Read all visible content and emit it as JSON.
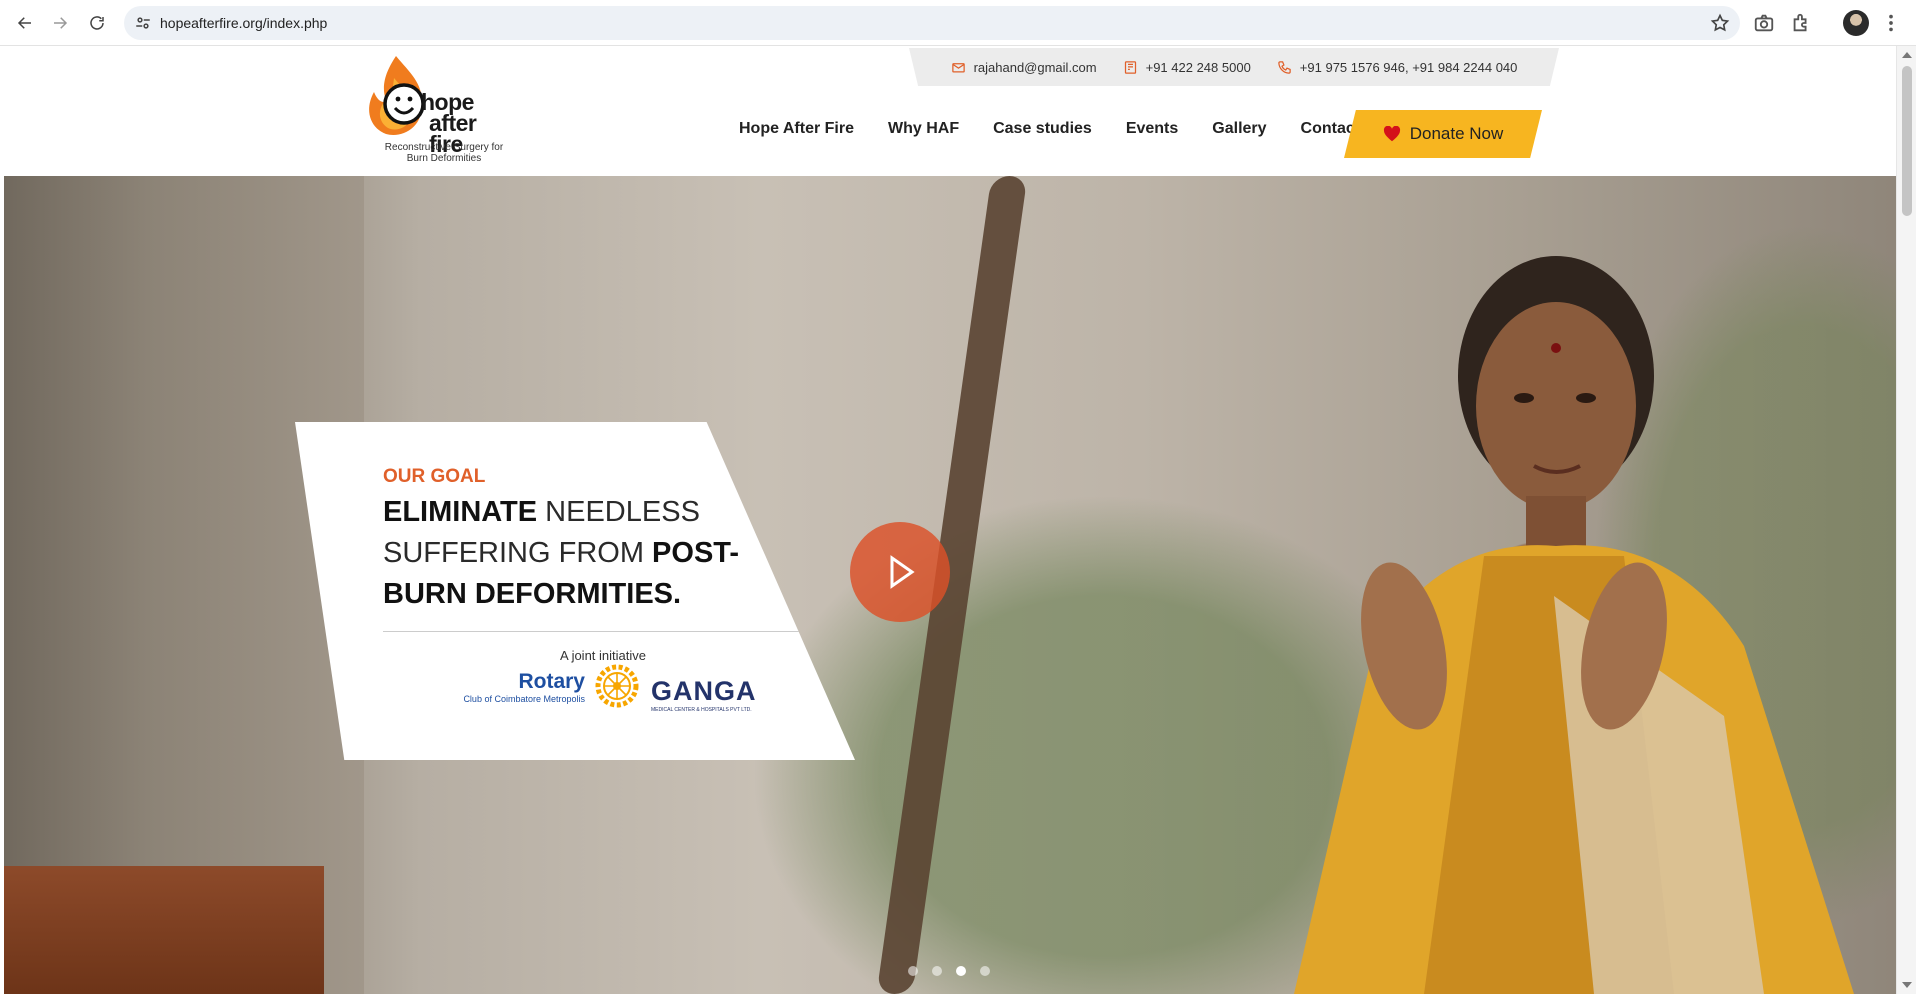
{
  "browser": {
    "url": "hopeafterfire.org/index.php"
  },
  "site": {
    "logo_line1": "hope",
    "logo_line2": "after fire",
    "logo_tagline": "Reconstructive Surgery for Burn Deformities",
    "contact": {
      "email": "rajahand@gmail.com",
      "landline": "+91 422 248 5000",
      "mobile": "+91 975 1576 946, +91 984 2244 040"
    },
    "nav": [
      "Hope After Fire",
      "Why HAF",
      "Case studies",
      "Events",
      "Gallery",
      "Contact"
    ],
    "donate_label": "Donate Now"
  },
  "hero": {
    "kicker": "OUR GOAL",
    "headline_part1": "ELIMINATE",
    "headline_part2": " NEEDLESS SUFFERING FROM ",
    "headline_part3": "POST-BURN DEFORMITIES.",
    "joint_text": "A joint initiative",
    "rotary_name": "Rotary",
    "rotary_sub": "Club of Coimbatore Metropolis",
    "ganga_name": "GANGA",
    "ganga_sub": "MEDICAL CENTER & HOSPITALS PVT LTD.",
    "slides_total": 4,
    "active_slide": 3
  },
  "colors": {
    "accent_orange": "#e0602a",
    "donate_yellow": "#f7b520",
    "rotary_blue": "#1e4fa1",
    "ganga_navy": "#23336a"
  }
}
